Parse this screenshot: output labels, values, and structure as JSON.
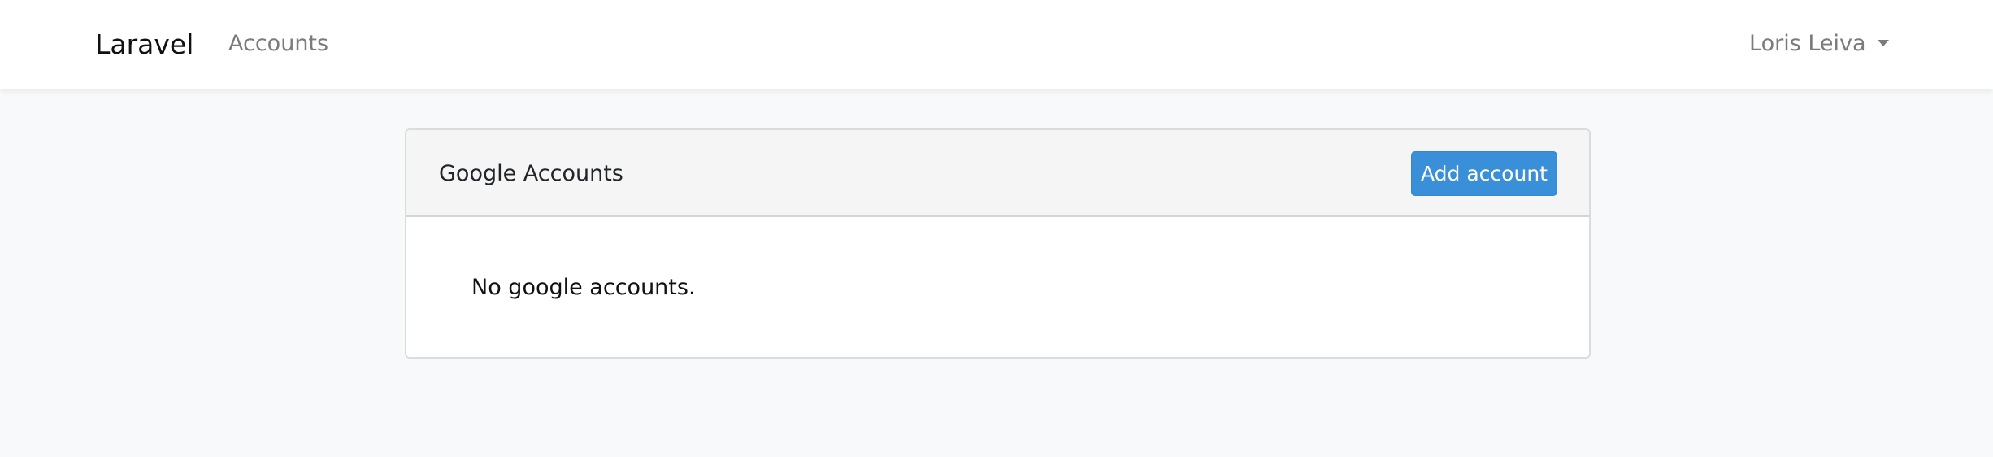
{
  "navbar": {
    "brand": "Laravel",
    "links": [
      {
        "label": "Accounts"
      }
    ],
    "user": {
      "name": "Loris Leiva",
      "icon": "caret-down-icon"
    }
  },
  "card": {
    "title": "Google Accounts",
    "add_button_label": "Add account",
    "empty_message": "No google accounts."
  },
  "colors": {
    "page_background": "#f8f9fa",
    "navbar_background": "#ffffff",
    "card_header_background": "#f5f5f5",
    "primary_button": "#3a8fd9",
    "muted_text": "#7b7b7b"
  }
}
